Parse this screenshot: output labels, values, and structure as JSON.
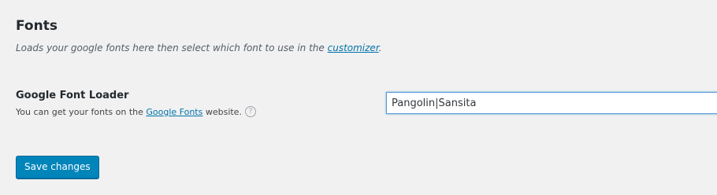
{
  "section": {
    "title": "Fonts",
    "description_before": "Loads your google fonts here then select which font to use in the ",
    "description_link": "customizer",
    "description_after": "."
  },
  "field": {
    "label": "Google Font Loader",
    "help_before": "You can get your fonts on the ",
    "help_link": "Google Fonts",
    "help_after": " website.",
    "help_icon": "question-circle-icon",
    "value": "Pangolin|Sansita"
  },
  "actions": {
    "save_label": "Save changes"
  },
  "colors": {
    "background": "#f1f1f1",
    "link": "#0073aa",
    "button": "#0085ba",
    "input_focus_border": "#5b9dd9"
  }
}
